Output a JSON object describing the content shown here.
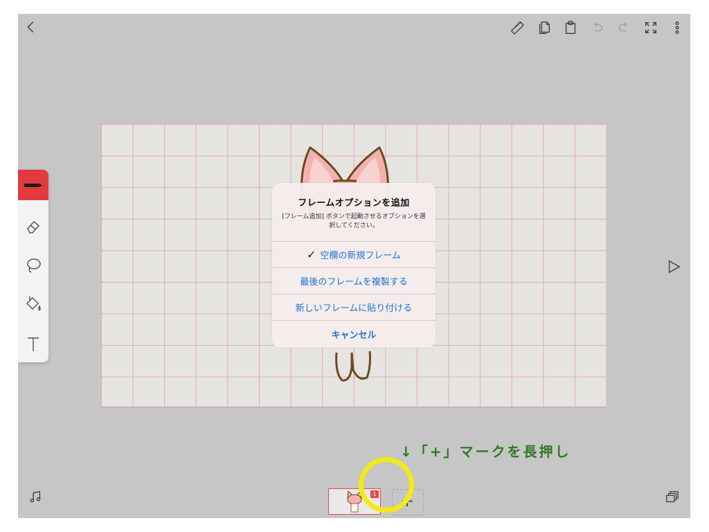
{
  "dialog": {
    "title": "フレームオプションを追加",
    "message": "[フレーム追加] ボタンで起動させるオプションを選択してください。",
    "options": [
      {
        "label": "空欄の新規フレーム",
        "checked": true
      },
      {
        "label": "最後のフレームを複製する",
        "checked": false
      },
      {
        "label": "新しいフレームに貼り付ける",
        "checked": false
      }
    ],
    "cancel_label": "キャンセル",
    "checkmark": "✓"
  },
  "timeline": {
    "frame_number": "1",
    "add_symbol": "+"
  },
  "annotation": {
    "text": "↓「+」マークを長押し",
    "color": "#2e7a22"
  },
  "colors": {
    "app_background": "#c6c6c6",
    "accent_red": "#e23a3f",
    "link_blue": "#1a76d2",
    "highlight_yellow": "#f3ea14"
  },
  "icons": {
    "toolbar": [
      "chevron-left-icon",
      "ruler-icon",
      "copy-icon",
      "paste-icon",
      "undo-icon",
      "redo-icon",
      "fullscreen-icon",
      "more-icon"
    ],
    "tools": [
      "pen-icon",
      "eraser-icon",
      "lasso-icon",
      "fill-bucket-icon",
      "text-icon"
    ],
    "bottom": [
      "music-note-icon",
      "layers-icon",
      "play-icon"
    ]
  }
}
